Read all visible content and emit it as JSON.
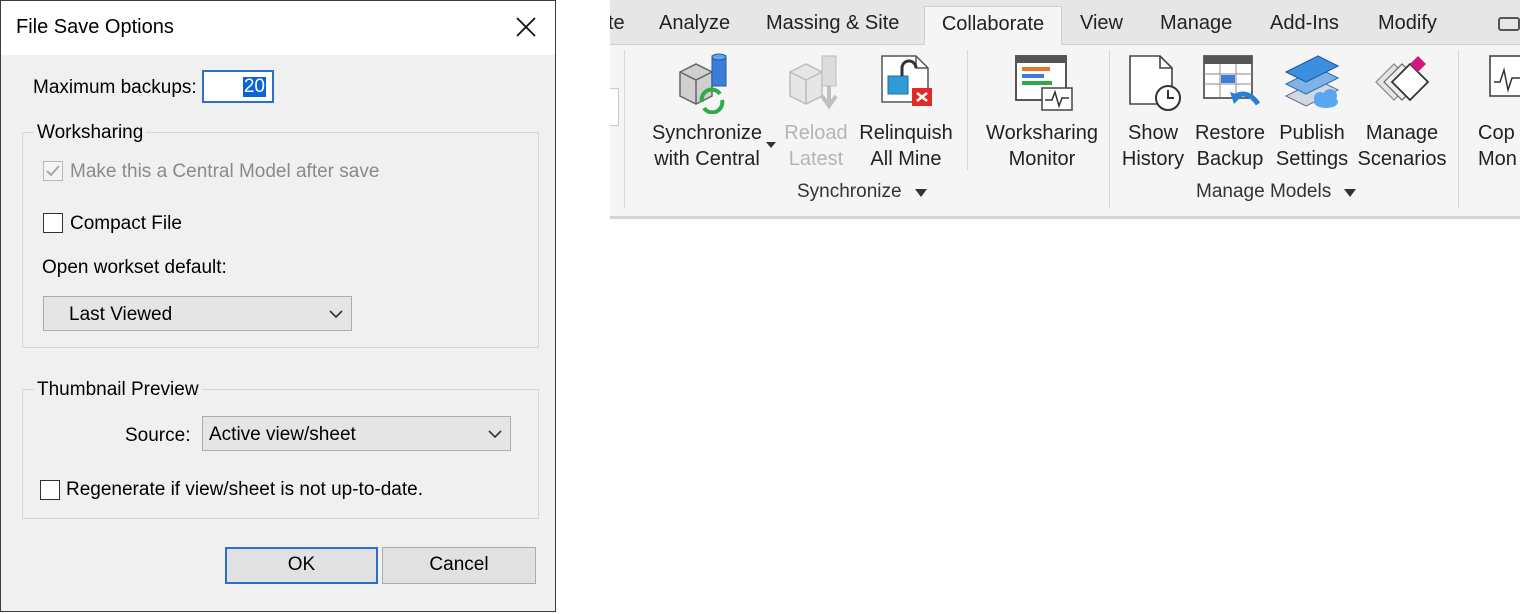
{
  "dialog": {
    "title": "File Save Options",
    "max_backups_label": "Maximum backups:",
    "max_backups_value": "20",
    "worksharing": {
      "title": "Worksharing",
      "central_model_label": "Make this a Central Model after save",
      "central_model_checked": true,
      "compact_file_label": "Compact File",
      "compact_file_checked": false,
      "open_workset_label": "Open workset default:",
      "open_workset_value": "Last Viewed"
    },
    "thumbnail": {
      "title": "Thumbnail Preview",
      "source_label": "Source:",
      "source_value": "Active view/sheet",
      "regenerate_label": "Regenerate if view/sheet is not up-to-date.",
      "regenerate_checked": false
    },
    "ok_label": "OK",
    "cancel_label": "Cancel"
  },
  "ribbon": {
    "tabs": [
      "te",
      "Analyze",
      "Massing & Site",
      "Collaborate",
      "View",
      "Manage",
      "Add-Ins",
      "Modify"
    ],
    "active_tab": "Collaborate",
    "tools": {
      "synchronize": [
        "Synchronize",
        "with Central"
      ],
      "reload": [
        "Reload",
        "Latest"
      ],
      "relinquish": [
        "Relinquish",
        "All Mine"
      ],
      "monitor": [
        "Worksharing",
        "Monitor"
      ],
      "show_history": [
        "Show",
        "History"
      ],
      "restore_backup": [
        "Restore",
        "Backup"
      ],
      "publish_settings": [
        "Publish",
        "Settings"
      ],
      "manage_scenarios": [
        "Manage",
        "Scenarios"
      ],
      "copy_monitor": [
        "Cop",
        "Mon"
      ]
    },
    "panels": {
      "synchronize": "Synchronize",
      "manage_models": "Manage Models"
    }
  }
}
